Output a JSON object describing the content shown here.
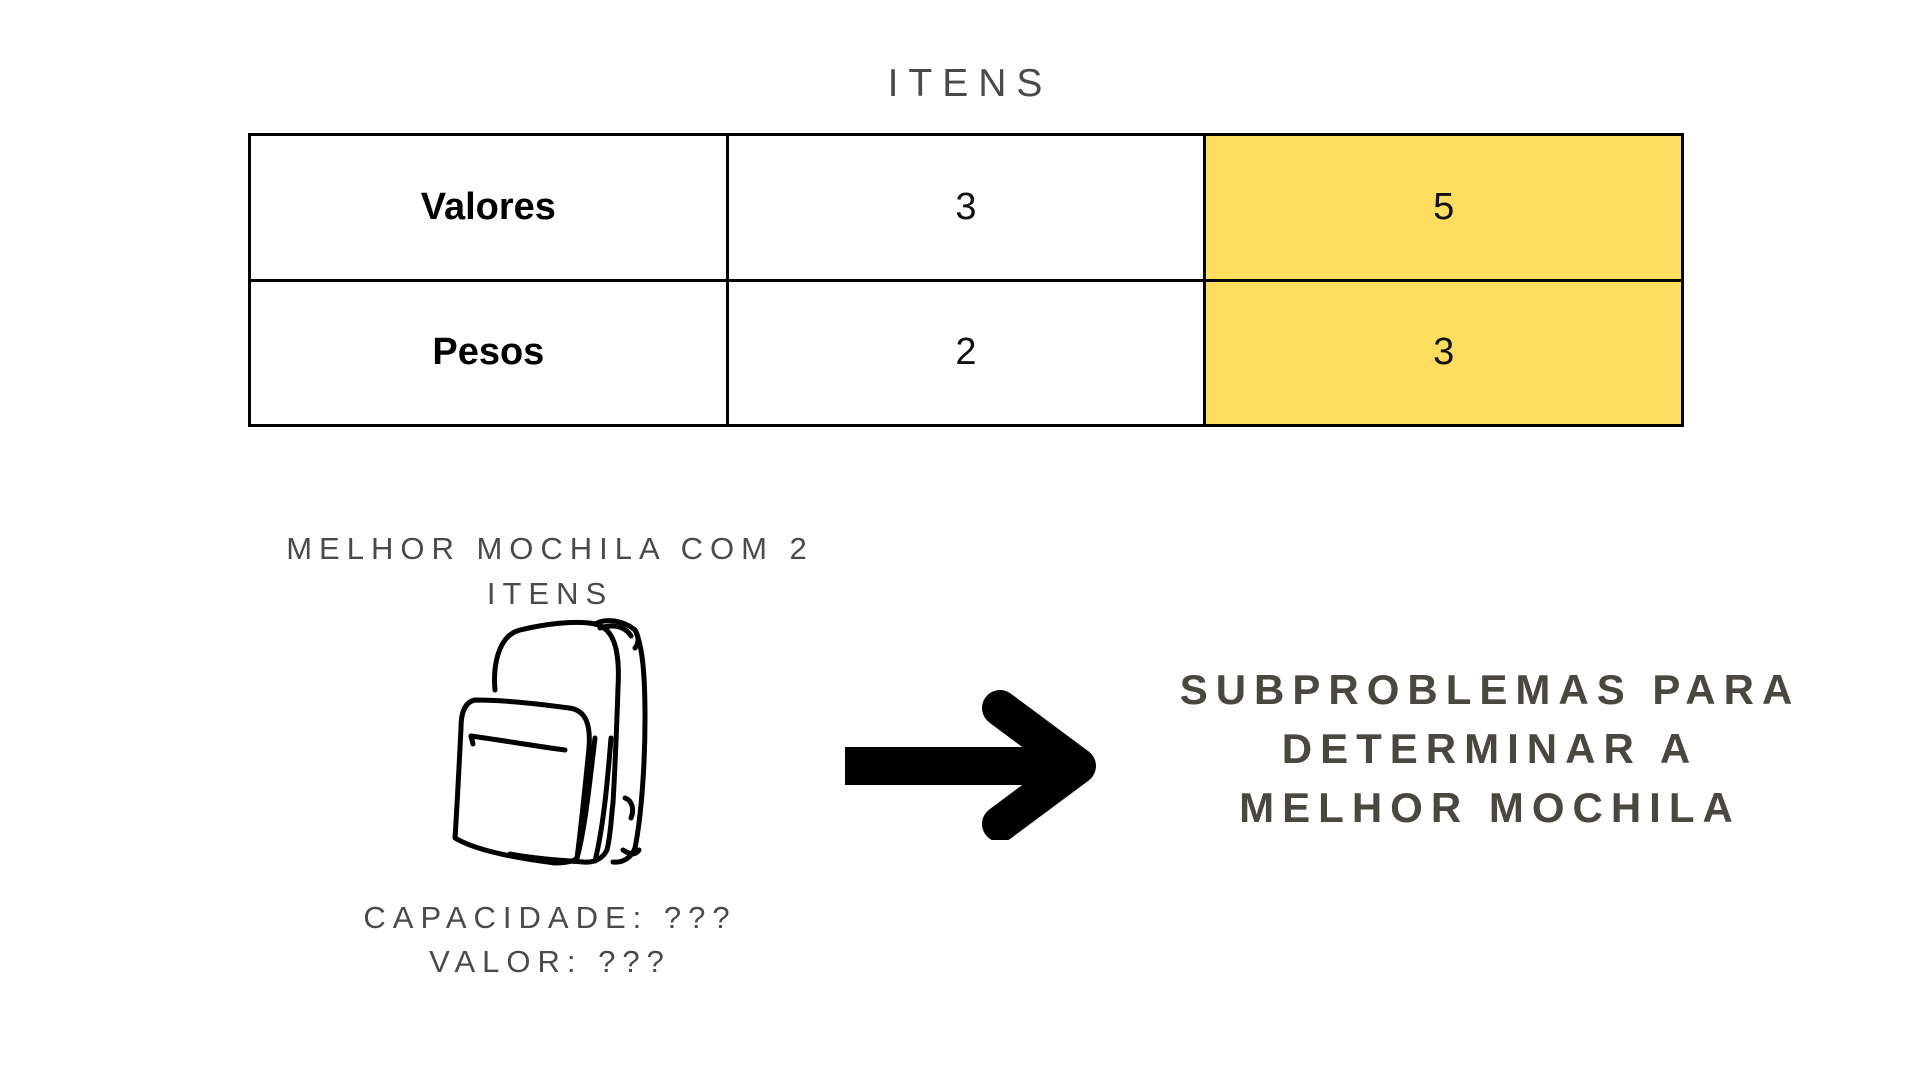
{
  "title": "ITENS",
  "table": {
    "rows": [
      {
        "label": "Valores",
        "cells": [
          "3",
          "5"
        ]
      },
      {
        "label": "Pesos",
        "cells": [
          "2",
          "3"
        ]
      }
    ],
    "highlight_color": "#ffde5f"
  },
  "knapsack": {
    "label_line1": "MELHOR MOCHILA COM 2",
    "label_line2": "ITENS",
    "icon": "backpack-icon",
    "capacity": "CAPACIDADE: ???",
    "value": "VALOR: ???"
  },
  "arrow_icon": "arrow-right-icon",
  "subproblems": {
    "line1": "SUBPROBLEMAS PARA",
    "line2": "DETERMINAR A",
    "line3": "MELHOR MOCHILA"
  }
}
